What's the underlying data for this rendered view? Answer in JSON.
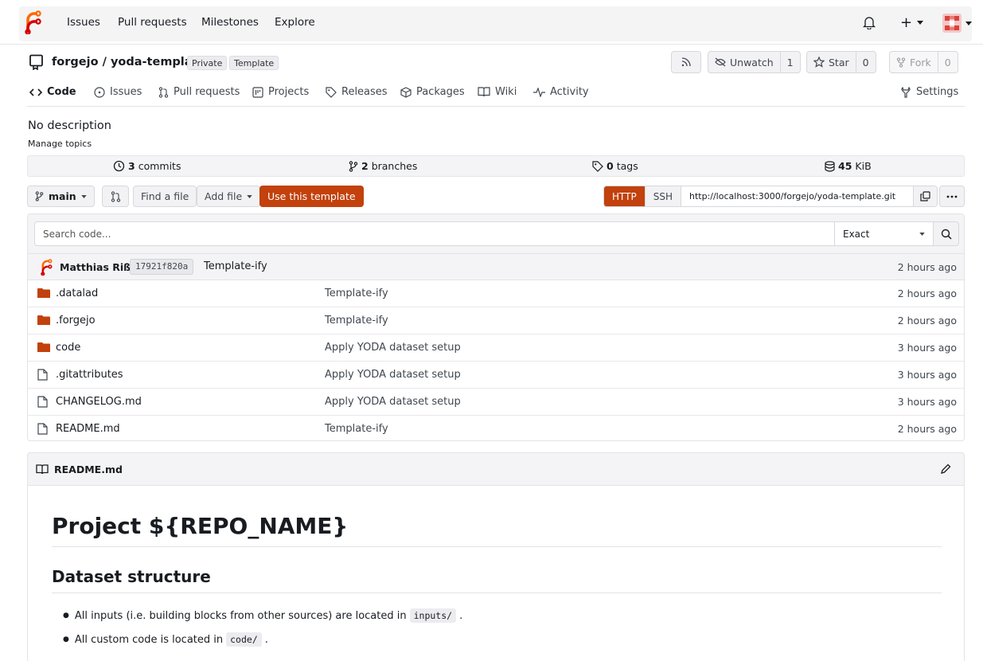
{
  "nav": {
    "links": [
      "Issues",
      "Pull requests",
      "Milestones",
      "Explore"
    ],
    "plus_label": "+"
  },
  "repo": {
    "title": "forgejo / yoda-template",
    "labels": [
      "Private",
      "Template"
    ],
    "unwatch_label": "Unwatch",
    "watch_count": "1",
    "star_label": "Star",
    "star_count": "0",
    "fork_label": "Fork",
    "fork_count": "0"
  },
  "tabs": [
    {
      "label": "Code",
      "icon": "code-icon"
    },
    {
      "label": "Issues",
      "icon": "issue-icon"
    },
    {
      "label": "Pull requests",
      "icon": "pull-request-icon"
    },
    {
      "label": "Projects",
      "icon": "project-icon"
    },
    {
      "label": "Releases",
      "icon": "tag-icon"
    },
    {
      "label": "Packages",
      "icon": "package-icon"
    },
    {
      "label": "Wiki",
      "icon": "book-icon"
    },
    {
      "label": "Activity",
      "icon": "pulse-icon"
    }
  ],
  "settings_label": "Settings",
  "description": "No description",
  "manage_topics": "Manage topics",
  "stats": {
    "commits_count": "3",
    "commits_label": "commits",
    "branches_count": "2",
    "branches_label": "branches",
    "tags_count": "0",
    "tags_label": "tags",
    "size_value": "45",
    "size_unit": "KiB"
  },
  "toolbar": {
    "branch": "main",
    "find_file": "Find a file",
    "add_file": "Add file",
    "use_template": "Use this template"
  },
  "clone": {
    "http": "HTTP",
    "ssh": "SSH",
    "url": "http://localhost:3000/forgejo/yoda-template.git"
  },
  "search": {
    "placeholder": "Search code...",
    "mode": "Exact"
  },
  "latest_commit": {
    "author": "Matthias Riße",
    "sha": "17921f820a",
    "message": "Template-ify",
    "time": "2 hours ago"
  },
  "files": [
    {
      "name": ".datalad",
      "type": "folder",
      "message": "Template-ify",
      "time": "2 hours ago"
    },
    {
      "name": ".forgejo",
      "type": "folder",
      "message": "Template-ify",
      "time": "2 hours ago"
    },
    {
      "name": "code",
      "type": "folder",
      "message": "Apply YODA dataset setup",
      "time": "3 hours ago"
    },
    {
      "name": ".gitattributes",
      "type": "file",
      "message": "Apply YODA dataset setup",
      "time": "3 hours ago"
    },
    {
      "name": "CHANGELOG.md",
      "type": "file",
      "message": "Apply YODA dataset setup",
      "time": "3 hours ago"
    },
    {
      "name": "README.md",
      "type": "file",
      "message": "Template-ify",
      "time": "2 hours ago"
    }
  ],
  "readme": {
    "filename": "README.md",
    "h1": "Project ${REPO_NAME}",
    "h2": "Dataset structure",
    "items": [
      {
        "text": "All inputs (i.e. building blocks from other sources) are located in",
        "code": "inputs/",
        "tail": "."
      },
      {
        "text": "All custom code is located in",
        "code": "code/",
        "tail": "."
      }
    ]
  },
  "colors": {
    "accent": "#c2410c",
    "folder": "#c2410c"
  }
}
